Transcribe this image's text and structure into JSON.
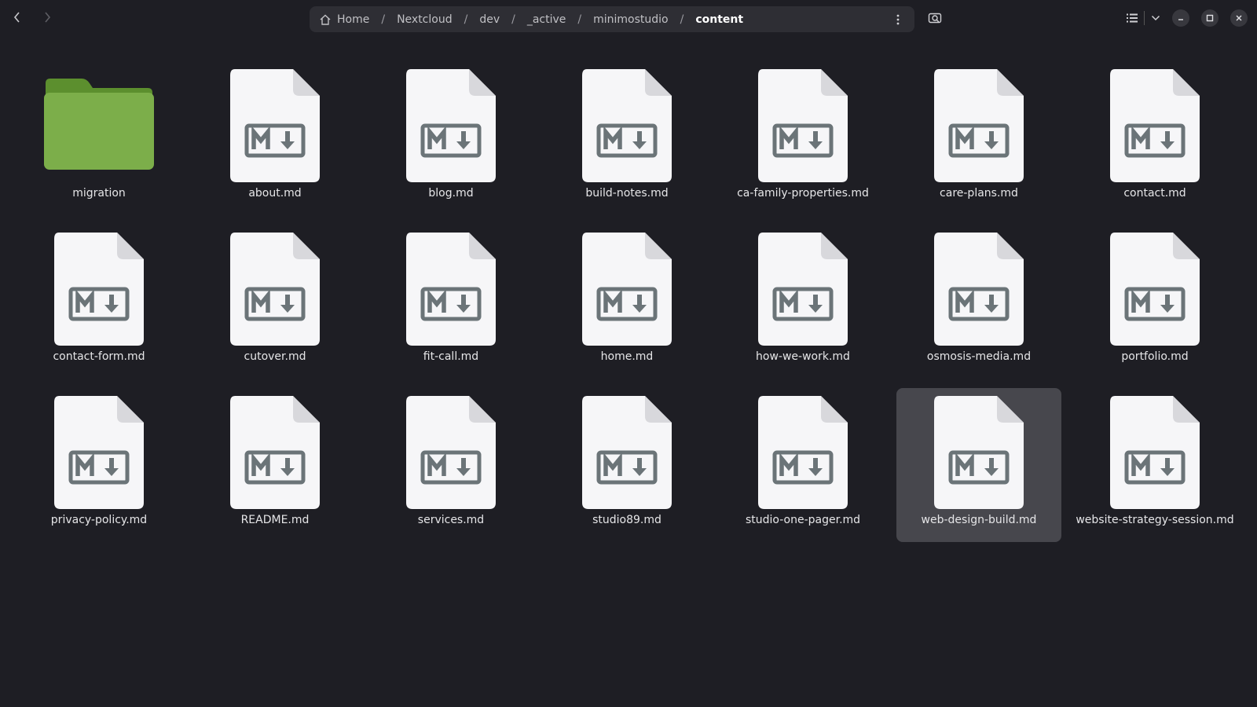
{
  "nav": {
    "back_icon": "chevron-left-icon",
    "forward_icon": "chevron-right-icon"
  },
  "path": {
    "home_icon": "home-icon",
    "separator": "/",
    "crumbs": [
      "Home",
      "Nextcloud",
      "dev",
      "_active",
      "minimostudio",
      "content"
    ]
  },
  "toolbar": {
    "path_menu_icon": "kebab-menu-icon",
    "search_icon": "search-icon",
    "view_icon": "list-view-icon",
    "view_dropdown_icon": "chevron-down-icon"
  },
  "window": {
    "minimize_icon": "minimize-icon",
    "maximize_icon": "maximize-icon",
    "close_icon": "close-icon"
  },
  "files": [
    {
      "name": "migration",
      "type": "folder"
    },
    {
      "name": "about.md",
      "type": "markdown"
    },
    {
      "name": "blog.md",
      "type": "markdown"
    },
    {
      "name": "build-notes.md",
      "type": "markdown"
    },
    {
      "name": "ca-family-properties.md",
      "type": "markdown"
    },
    {
      "name": "care-plans.md",
      "type": "markdown"
    },
    {
      "name": "contact.md",
      "type": "markdown"
    },
    {
      "name": "contact-form.md",
      "type": "markdown"
    },
    {
      "name": "cutover.md",
      "type": "markdown"
    },
    {
      "name": "fit-call.md",
      "type": "markdown"
    },
    {
      "name": "home.md",
      "type": "markdown"
    },
    {
      "name": "how-we-work.md",
      "type": "markdown"
    },
    {
      "name": "osmosis-media.md",
      "type": "markdown"
    },
    {
      "name": "portfolio.md",
      "type": "markdown"
    },
    {
      "name": "privacy-policy.md",
      "type": "markdown"
    },
    {
      "name": "README.md",
      "type": "markdown"
    },
    {
      "name": "services.md",
      "type": "markdown"
    },
    {
      "name": "studio89.md",
      "type": "markdown"
    },
    {
      "name": "studio-one-pager.md",
      "type": "markdown"
    },
    {
      "name": "web-design-build.md",
      "type": "markdown",
      "selected": true
    },
    {
      "name": "website-strategy-session.md",
      "type": "markdown"
    }
  ],
  "colors": {
    "background": "#1e1e24",
    "folder": "#7cae4a",
    "folder_tab": "#5c8f2e",
    "selection": "#47474d",
    "doc": "#f6f6f8",
    "md_glyph": "#6b7478"
  }
}
